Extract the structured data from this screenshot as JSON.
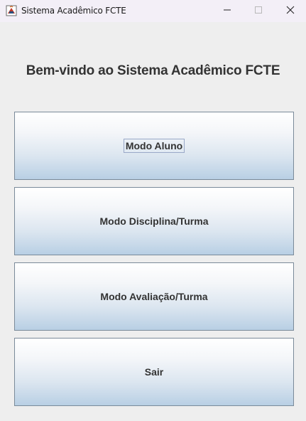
{
  "window": {
    "title": "Sistema Acadêmico FCTE"
  },
  "main": {
    "heading": "Bem-vindo ao Sistema Acadêmico FCTE",
    "buttons": [
      {
        "label": "Modo Aluno",
        "focused": true
      },
      {
        "label": "Modo Disciplina/Turma",
        "focused": false
      },
      {
        "label": "Modo Avaliação/Turma",
        "focused": false
      },
      {
        "label": "Sair",
        "focused": false
      }
    ]
  },
  "icons": {
    "app": "java-app-icon",
    "minimize": "minimize-icon",
    "maximize": "maximize-icon",
    "close": "close-icon"
  },
  "colors": {
    "titlebar": "#f3eff7",
    "background": "#eeeeee",
    "button_border": "#7a8a99",
    "button_gradient_top": "#ffffff",
    "button_gradient_bottom": "#b8cfe4",
    "text": "#333333"
  }
}
